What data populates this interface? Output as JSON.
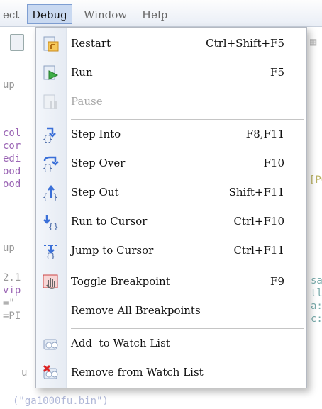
{
  "menubar": {
    "items": [
      {
        "label": "ect",
        "active": false
      },
      {
        "label": "Debug",
        "active": true
      },
      {
        "label": "Window",
        "active": false
      },
      {
        "label": "Help",
        "active": false
      }
    ]
  },
  "editor": {
    "left_lines": [
      "up",
      "col",
      "cor",
      "edi",
      "ood",
      "ood",
      "up",
      "2.1",
      "vip",
      "=\"",
      "=PI",
      "u"
    ],
    "right_lines": [
      "[PG",
      "sa",
      "tl",
      "a:",
      "c:"
    ],
    "bottom_line": "(\"ga1000fu.bin\")"
  },
  "debug_menu": {
    "items": [
      {
        "label": "Restart",
        "shortcut": "Ctrl+Shift+F5",
        "icon": "restart-icon",
        "enabled": true
      },
      {
        "label": "Run",
        "shortcut": "F5",
        "icon": "run-icon",
        "enabled": true
      },
      {
        "label": "Pause",
        "shortcut": "",
        "icon": "pause-icon",
        "enabled": false
      },
      {
        "label": "Step Into",
        "shortcut": "F8,F11",
        "icon": "step-into-icon",
        "enabled": true
      },
      {
        "label": "Step Over",
        "shortcut": "F10",
        "icon": "step-over-icon",
        "enabled": true
      },
      {
        "label": "Step Out",
        "shortcut": "Shift+F11",
        "icon": "step-out-icon",
        "enabled": true
      },
      {
        "label": "Run to Cursor",
        "shortcut": "Ctrl+F10",
        "icon": "run-to-cursor-icon",
        "enabled": true
      },
      {
        "label": "Jump to Cursor",
        "shortcut": "Ctrl+F11",
        "icon": "jump-to-cursor-icon",
        "enabled": true
      },
      {
        "label": "Toggle Breakpoint",
        "shortcut": "F9",
        "icon": "breakpoint-hand-icon",
        "enabled": true
      },
      {
        "label": "Remove All Breakpoints",
        "shortcut": "",
        "icon": "",
        "enabled": true
      },
      {
        "label": "Add  to Watch List",
        "shortcut": "",
        "icon": "add-watch-icon",
        "enabled": true
      },
      {
        "label": "Remove from Watch List",
        "shortcut": "",
        "icon": "remove-watch-icon",
        "enabled": true
      }
    ]
  }
}
